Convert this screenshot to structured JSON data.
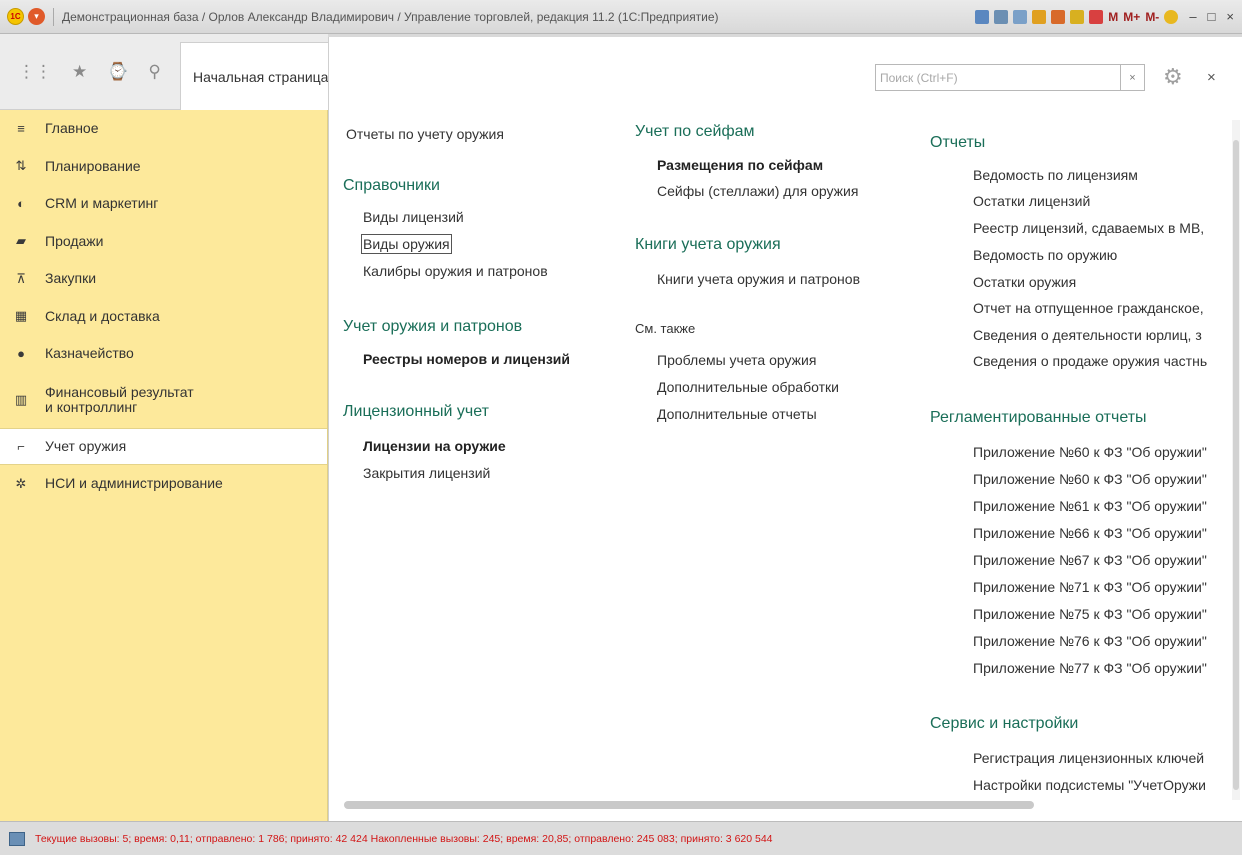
{
  "window": {
    "title": "Демонстрационная база / Орлов Александр Владимирович / Управление торговлей, редакция 11.2  (1С:Предприятие)",
    "tools": [
      "M",
      "M+",
      "M-"
    ]
  },
  "tabs": {
    "start_page": "Начальная страница"
  },
  "sidebar": {
    "items": [
      {
        "label": "Главное",
        "icon": "menu-lines-icon"
      },
      {
        "label": "Планирование",
        "icon": "planning-icon"
      },
      {
        "label": "CRM и маркетинг",
        "icon": "crm-icon"
      },
      {
        "label": "Продажи",
        "icon": "bag-icon"
      },
      {
        "label": "Закупки",
        "icon": "cart-icon"
      },
      {
        "label": "Склад и доставка",
        "icon": "warehouse-icon"
      },
      {
        "label": "Казначейство",
        "icon": "treasury-icon"
      },
      {
        "label": "Финансовый результат и контроллинг",
        "icon": "chart-icon"
      },
      {
        "label": "Учет оружия",
        "icon": "weapon-icon",
        "active": true
      },
      {
        "label": "НСИ и администрирование",
        "icon": "gear-icon"
      }
    ]
  },
  "search": {
    "placeholder": "Поиск (Ctrl+F)",
    "clear": "×"
  },
  "panel": {
    "close": "×"
  },
  "col1": {
    "top_link": "Отчеты по учету оружия",
    "sections": [
      {
        "title": "Справочники",
        "links": [
          "Виды лицензий",
          "Виды оружия",
          "Калибры оружия и патронов"
        ]
      },
      {
        "title": "Учет оружия и патронов",
        "links": [
          "Реестры номеров и лицензий"
        ]
      },
      {
        "title": "Лицензионный учет",
        "links": [
          "Лицензии на оружие",
          "Закрытия лицензий"
        ]
      }
    ]
  },
  "col2": {
    "sections": [
      {
        "title": "Учет по сейфам",
        "links": [
          "Размещения по сейфам",
          "Сейфы (стеллажи) для оружия"
        ]
      },
      {
        "title": "Книги учета оружия",
        "links": [
          "Книги учета оружия и патронов"
        ]
      }
    ],
    "see_also": {
      "title": "См. также",
      "links": [
        "Проблемы учета оружия",
        "Дополнительные обработки",
        "Дополнительные отчеты"
      ]
    }
  },
  "col3": {
    "sections": [
      {
        "title": "Отчеты",
        "links": [
          "Ведомость по лицензиям",
          "Остатки лицензий",
          "Реестр лицензий, сдаваемых в МВ,",
          "Ведомость по оружию",
          "Остатки оружия",
          "Отчет на отпущенное гражданское,",
          "Сведения о деятельности юрлиц, з",
          "Сведения о продаже оружия частнь"
        ]
      },
      {
        "title": "Регламентированные отчеты",
        "links": [
          "Приложение №60 к ФЗ \"Об оружии\"",
          "Приложение №60 к ФЗ \"Об оружии\"",
          "Приложение №61 к ФЗ \"Об оружии\"",
          "Приложение №66 к ФЗ \"Об оружии\"",
          "Приложение №67 к ФЗ \"Об оружии\"",
          "Приложение №71 к ФЗ \"Об оружии\"",
          "Приложение №75 к ФЗ \"Об оружии\"",
          "Приложение №76 к ФЗ \"Об оружии\"",
          "Приложение №77 к ФЗ \"Об оружии\""
        ]
      },
      {
        "title": "Сервис и настройки",
        "links": [
          "Регистрация лицензионных ключей",
          "Настройки подсистемы \"УчетОружи"
        ]
      }
    ]
  },
  "status": {
    "text": "Текущие вызовы: 5; время: 0,11; отправлено: 1 786; принято: 42 424   Накопленные вызовы: 245; время: 20,85; отправлено: 245 083; принято: 3 620 544"
  }
}
